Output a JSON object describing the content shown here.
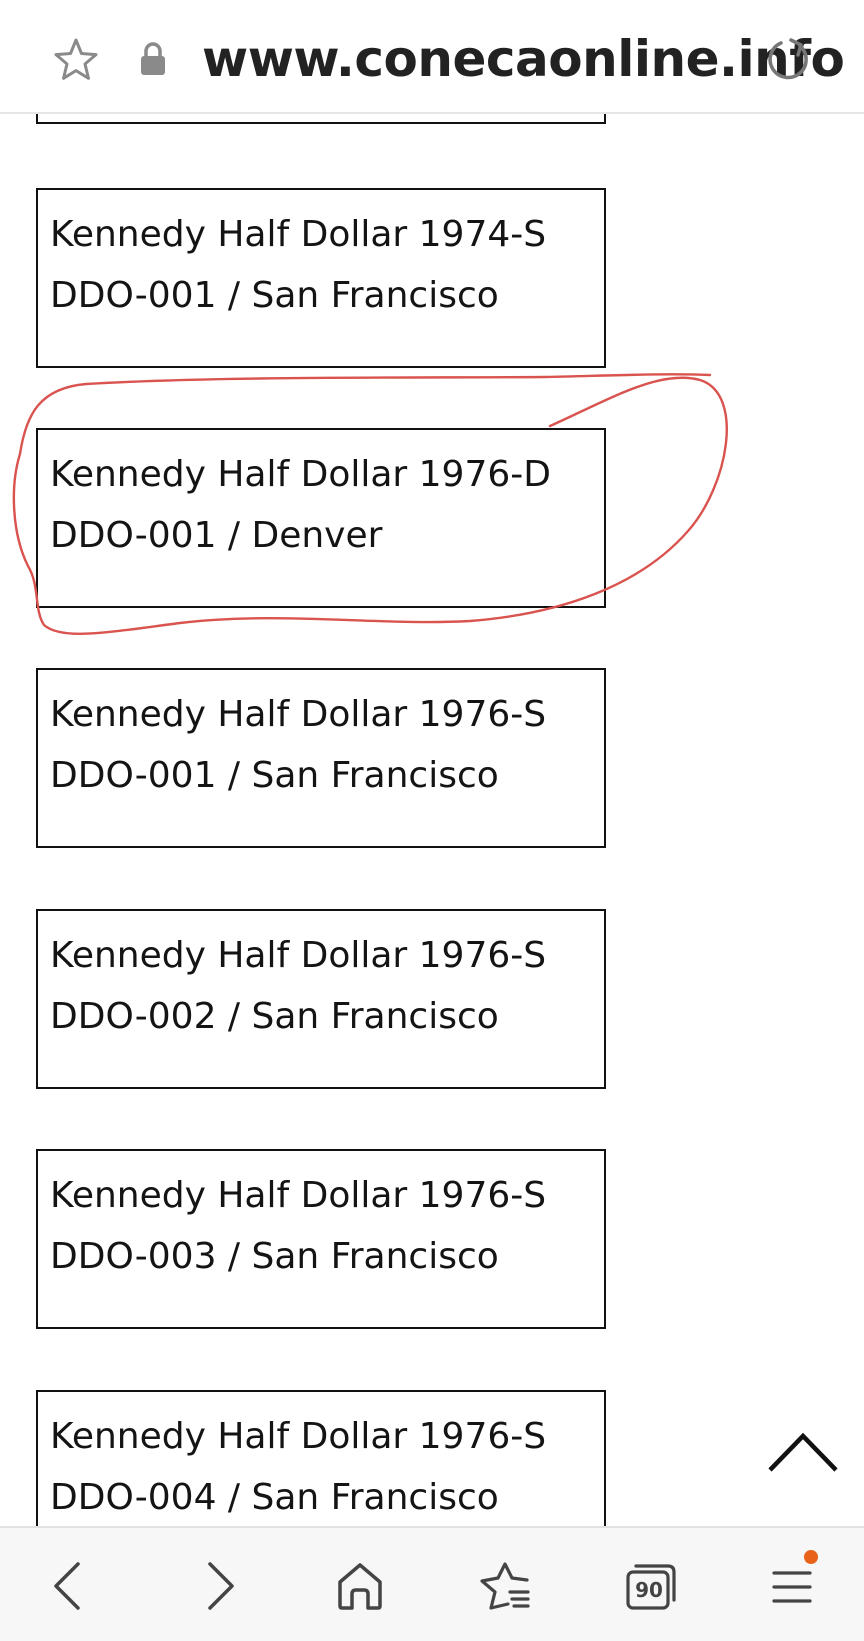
{
  "address_bar": {
    "url": "www.conecaonline.info",
    "icons": [
      "star-icon",
      "lock-icon",
      "reload-icon"
    ]
  },
  "cards": [
    {
      "line1": "Kennedy Half Dollar 1974-S",
      "line2": "DDO-001 / San Francisco"
    },
    {
      "line1": "Kennedy Half Dollar 1976-D",
      "line2": "DDO-001 / Denver",
      "highlighted": true
    },
    {
      "line1": "Kennedy Half Dollar 1976-S",
      "line2": "DDO-001 / San Francisco"
    },
    {
      "line1": "Kennedy Half Dollar 1976-S",
      "line2": "DDO-002 / San Francisco"
    },
    {
      "line1": "Kennedy Half Dollar 1976-S",
      "line2": "DDO-003 / San Francisco"
    },
    {
      "line1": "Kennedy Half Dollar 1976-S",
      "line2": "DDO-004 / San Francisco"
    }
  ],
  "annotation": {
    "color": "#d9534f"
  },
  "scroll_top": {
    "icon": "chevron-up-icon"
  },
  "bottom_toolbar": {
    "icons": [
      "back-icon",
      "forward-icon",
      "home-icon",
      "favorites-icon",
      "tabs-icon",
      "menu-icon"
    ],
    "tabs_count": "90",
    "notification_color": "#e8621a"
  }
}
